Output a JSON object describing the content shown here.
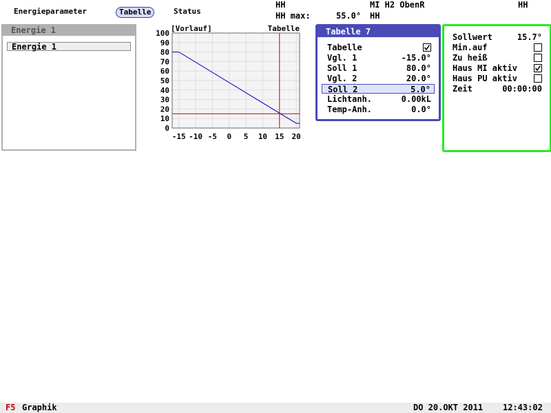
{
  "tabs": [
    "Energieparameter",
    "Tabelle",
    "Status"
  ],
  "status": {
    "r1_left": "HH",
    "r1_mid": "MI H2 ObenR",
    "r1_right": "HH",
    "r2_label": "HH max:",
    "r2_value": "55.0°",
    "r2_unit": "HH"
  },
  "energie_panel": {
    "title": "Energie 1",
    "items": [
      "Energie 1"
    ]
  },
  "chart_data": {
    "type": "line",
    "title_left": "[Vorlauf]",
    "title_right": "Tabelle",
    "xlim": [
      -17,
      21
    ],
    "ylim": [
      0,
      100
    ],
    "x_ticks": [
      -15,
      -10,
      -5,
      0,
      5,
      10,
      15,
      20
    ],
    "y_ticks": [
      0,
      10,
      20,
      30,
      40,
      50,
      60,
      70,
      80,
      90,
      100
    ],
    "series": [
      {
        "color": "#0000c0",
        "x": [
          -17,
          -15,
          20,
          21
        ],
        "y": [
          80,
          80,
          5,
          5
        ]
      }
    ],
    "cursor": {
      "x": 15,
      "y": 15,
      "color": "#cc0000"
    },
    "grid": true
  },
  "tabelle_panel": {
    "title": "Tabelle 7",
    "rows": [
      {
        "label": "Tabelle",
        "value": "",
        "checkbox": true,
        "checked": true,
        "selected": false
      },
      {
        "label": "Vgl. 1",
        "value": "-15.0°",
        "selected": false
      },
      {
        "label": "Soll 1",
        "value": "80.0°",
        "selected": false
      },
      {
        "label": "Vgl. 2",
        "value": "20.0°",
        "selected": false
      },
      {
        "label": "Soll 2",
        "value": "5.0°",
        "selected": true
      },
      {
        "label": "Lichtanh.",
        "value": "0.00kL",
        "selected": false
      },
      {
        "label": "Temp-Anh.",
        "value": "0.0°",
        "selected": false
      }
    ]
  },
  "soll_panel": {
    "rows": [
      {
        "label": "Sollwert",
        "value": "15.7°"
      },
      {
        "label": "Min.auf",
        "checkbox": true,
        "checked": false
      },
      {
        "label": "Zu heiß",
        "checkbox": true,
        "checked": false
      },
      {
        "label": "Haus MI aktiv",
        "checkbox": true,
        "checked": true
      },
      {
        "label": "Haus PU aktiv",
        "checkbox": true,
        "checked": false
      },
      {
        "label": "Zeit",
        "value": "00:00:00"
      }
    ],
    "border_color": "#22ee22"
  },
  "footer": {
    "key": "F5",
    "label": "Graphik",
    "date": "DO 20.OKT 2011",
    "time": "12:43:02"
  }
}
